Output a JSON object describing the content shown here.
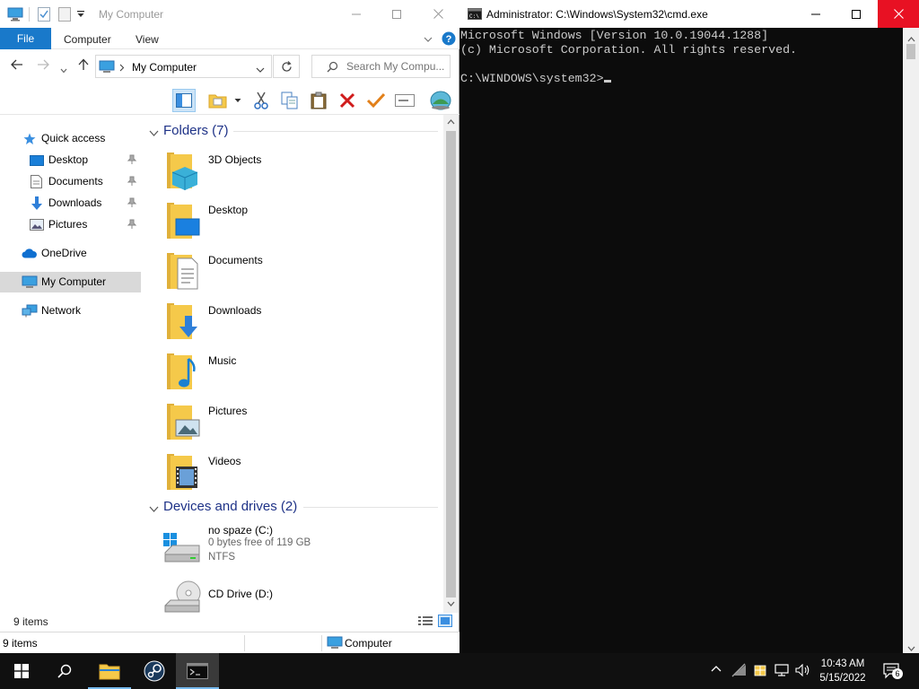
{
  "explorer": {
    "title": "My Computer",
    "tabs": {
      "file": "File",
      "computer": "Computer",
      "view": "View"
    },
    "address": "My Computer",
    "search_placeholder": "Search My Compu...",
    "nav": {
      "quick_access": "Quick access",
      "desktop": "Desktop",
      "documents": "Documents",
      "downloads": "Downloads",
      "pictures": "Pictures",
      "onedrive": "OneDrive",
      "my_computer": "My Computer",
      "network": "Network"
    },
    "folders_header": "Folders (7)",
    "folders": [
      "3D Objects",
      "Desktop",
      "Documents",
      "Downloads",
      "Music",
      "Pictures",
      "Videos"
    ],
    "drives_header": "Devices and drives (2)",
    "drives": [
      {
        "name": "no spaze (C:)",
        "free": "0 bytes free of 119 GB",
        "fs": "NTFS"
      },
      {
        "name": "CD Drive (D:)"
      }
    ],
    "items_count": "9 items",
    "status_items": "9 items",
    "status_location": "Computer"
  },
  "cmd": {
    "title": "Administrator: C:\\Windows\\System32\\cmd.exe",
    "lines": [
      "Microsoft Windows [Version 10.0.19044.1288]",
      "(c) Microsoft Corporation. All rights reserved.",
      "",
      "C:\\WINDOWS\\system32>"
    ]
  },
  "taskbar": {
    "time": "10:43 AM",
    "date": "5/15/2022",
    "notification_count": "6"
  },
  "colors": {
    "accent": "#1979ca",
    "folder_yellow": "#f5c94a",
    "close_red": "#e81123",
    "taskbar": "#101010",
    "console_bg": "#0c0c0c"
  }
}
